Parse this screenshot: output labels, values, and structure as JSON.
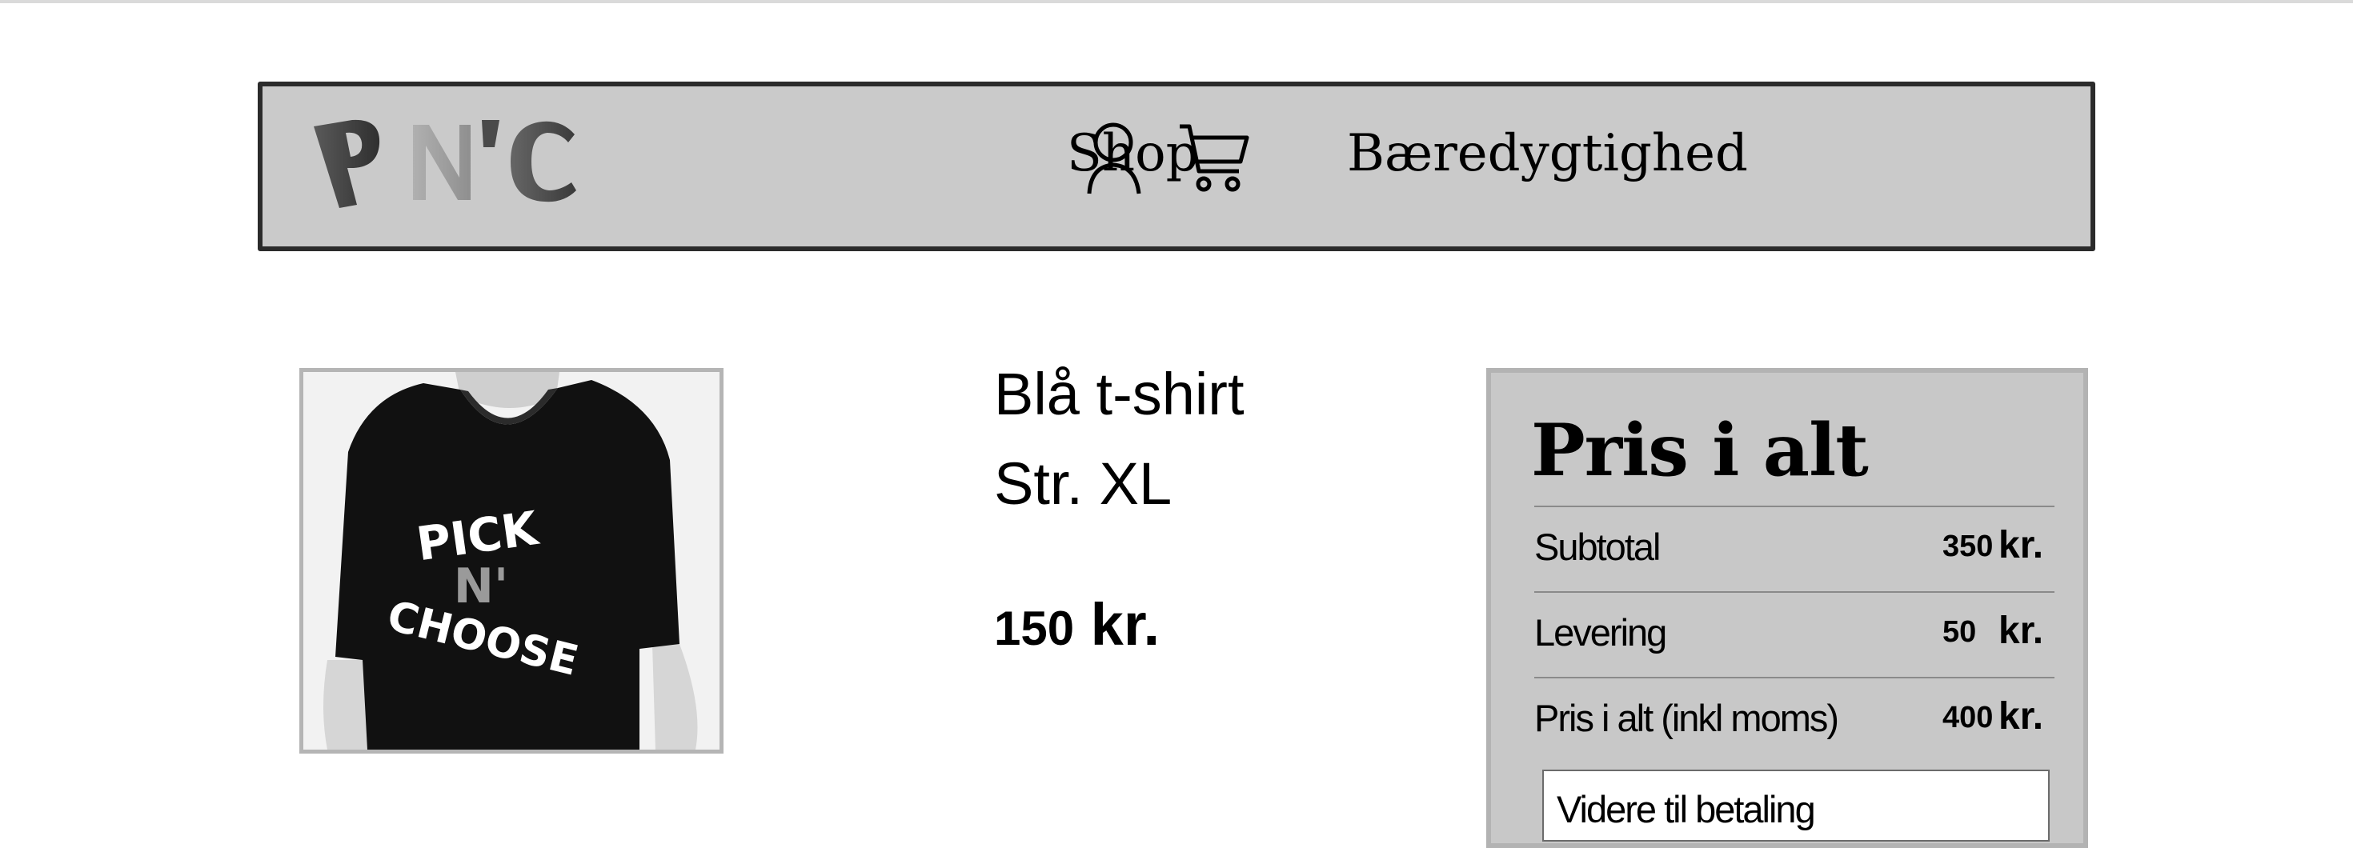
{
  "header": {
    "logo_text": "PN'C",
    "nav": {
      "shop_label": "Shop",
      "sustainability_label": "Bæredygtighed"
    },
    "icons": [
      "user-icon",
      "cart-icon"
    ]
  },
  "product": {
    "image_print_text": [
      "PICK",
      "N'",
      "CHOOSE"
    ],
    "name": "Blå t-shirt",
    "size": "Str. XL",
    "price_value": "150",
    "price_unit": "kr."
  },
  "summary": {
    "title": "Pris i alt",
    "rows": [
      {
        "label": "Subtotal",
        "amount": "350",
        "unit": "kr."
      },
      {
        "label": "Levering",
        "amount": "50",
        "unit": "kr."
      },
      {
        "label": "Pris i alt (inkl moms)",
        "amount": "400",
        "unit": "kr."
      }
    ],
    "pay_button_label": "Videre til betaling"
  },
  "colors": {
    "header_bg": "#cacaca",
    "header_border": "#2b2b2b",
    "panel_bg": "#c8c8c8",
    "panel_border": "#b3b3b3"
  }
}
